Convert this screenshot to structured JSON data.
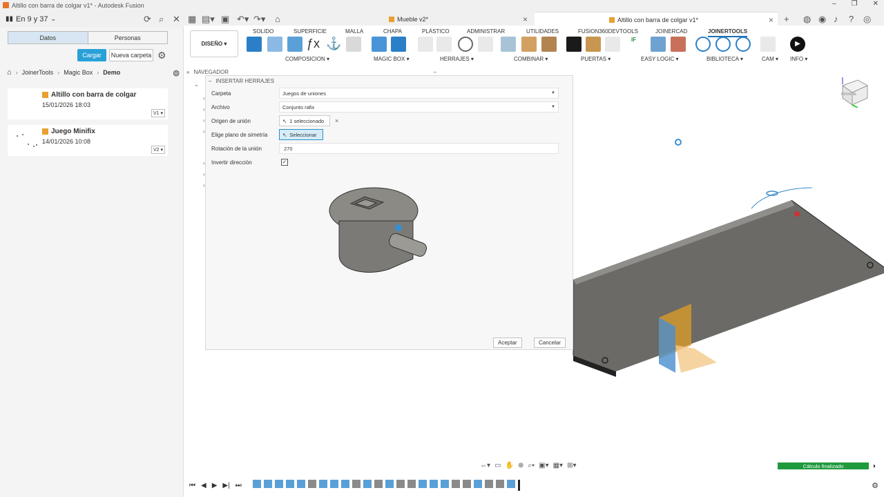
{
  "window": {
    "title": "Altillo con barra de colgar v1* - Autodesk Fusion",
    "project": "En 9 y 37"
  },
  "tabs": [
    {
      "label": "Mueble v2*"
    },
    {
      "label": "Altillo con barra de colgar v1*"
    }
  ],
  "left_panel": {
    "tabs": [
      "Datos",
      "Personas"
    ],
    "upload_button": "Cargar",
    "new_folder_button": "Nueva carpeta",
    "breadcrumb": [
      "JoinerTools",
      "Magic Box",
      "Demo"
    ],
    "files": [
      {
        "name": "Altillo con barra de colgar",
        "date": "15/01/2026 18:03",
        "version": "V1"
      },
      {
        "name": "Juego Minifix",
        "date": "14/01/2026 10:08",
        "version": "V2"
      }
    ]
  },
  "ribbon": {
    "design_button": "DISEÑO",
    "tabs": [
      "SOLIDO",
      "SUPERFICIE",
      "MALLA",
      "CHAPA",
      "PLÁSTICO",
      "ADMINISTRAR",
      "UTILIDADES",
      "FUSION360DEVTOOLS",
      "JOINERCAD",
      "JOINERTOOLS"
    ],
    "active_tab": "JOINERTOOLS",
    "groups": [
      "COMPOSICION",
      "MAGIC BOX",
      "HERRAJES",
      "COMBINAR",
      "PUERTAS",
      "EASY LOGIC",
      "BIBLIOTECA",
      "CAM",
      "INFO"
    ]
  },
  "navigator": {
    "label": "NAVEGADOR"
  },
  "dialog": {
    "title": "INSERTAR HERRAJES",
    "rows": {
      "carpeta_label": "Carpeta",
      "carpeta_value": "Juegos de uniones",
      "archivo_label": "Archivo",
      "archivo_value": "Conjunto rafix",
      "origen_label": "Origen de unión",
      "origen_value": "1 seleccionado",
      "plano_label": "Elige plano de simetría",
      "plano_value": "Seleccionar",
      "rotacion_label": "Rotación de la unión",
      "rotacion_value": "270",
      "invertir_label": "Invertir dirección"
    },
    "accept_button": "Aceptar",
    "cancel_button": "Cancelar"
  },
  "viewcube": {
    "label": "FRONTAL"
  },
  "status": "Cálculo finalizado"
}
